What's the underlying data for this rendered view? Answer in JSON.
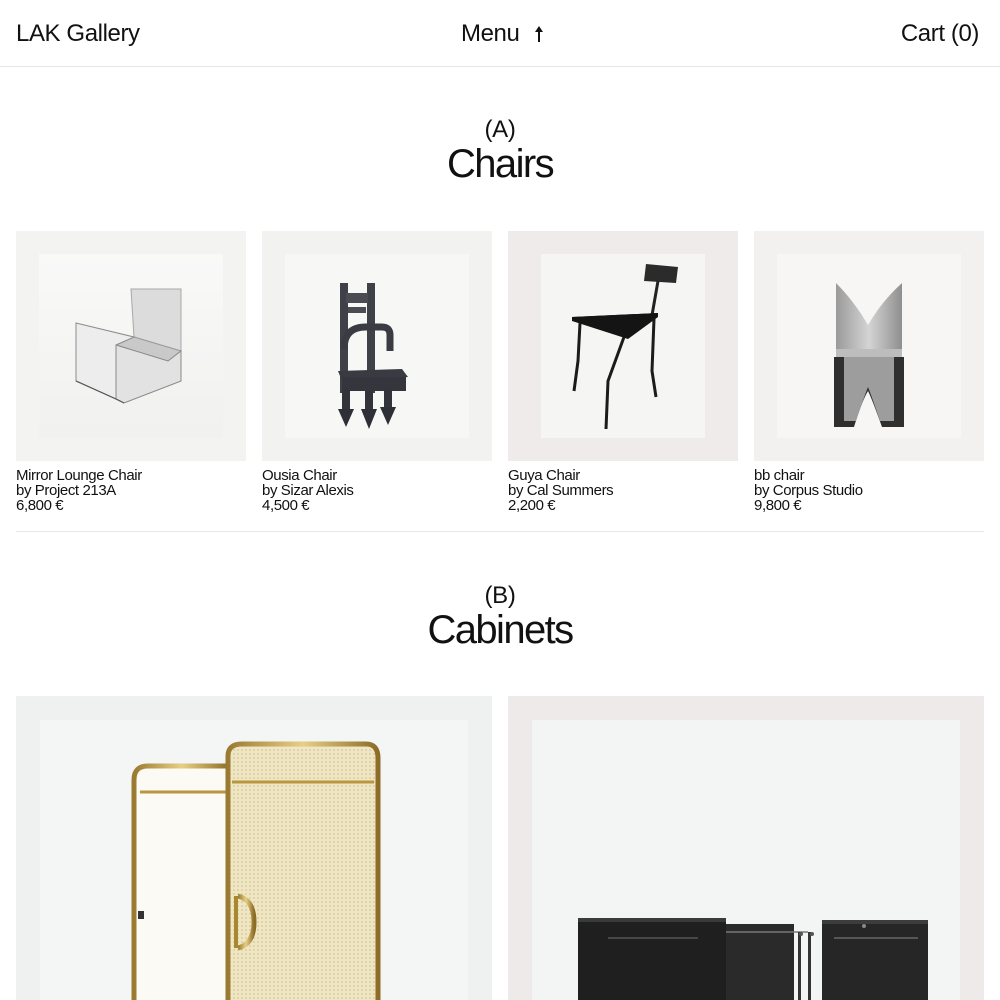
{
  "header": {
    "brand": "LAK Gallery",
    "menu_label": "Menu",
    "menu_icon": "arrow-up-icon",
    "cart_label": "Cart (0)"
  },
  "sections": [
    {
      "letter": "(A)",
      "title": "Chairs",
      "products": [
        {
          "name": "Mirror Lounge Chair",
          "maker": "by Project 213A",
          "price": "6,800 €",
          "image_icon": "mirror-lounge-chair-image"
        },
        {
          "name": "Ousia Chair",
          "maker": "by Sizar Alexis",
          "price": "4,500 €",
          "image_icon": "ousia-chair-image"
        },
        {
          "name": "Guya Chair",
          "maker": "by Cal Summers",
          "price": "2,200 €",
          "image_icon": "guya-chair-image"
        },
        {
          "name": "bb chair",
          "maker": "by Corpus Studio",
          "price": "9,800 €",
          "image_icon": "bb-chair-image"
        }
      ]
    },
    {
      "letter": "(B)",
      "title": "Cabinets",
      "products": [
        {
          "image_icon": "brass-mesh-cabinet-image"
        },
        {
          "image_icon": "black-metal-cabinet-image"
        }
      ]
    }
  ],
  "colors": {
    "text": "#111111",
    "card_bg_light": "#f2f2f0",
    "card_bg_warm": "#efeceb",
    "divider": "#e8e8e8"
  }
}
